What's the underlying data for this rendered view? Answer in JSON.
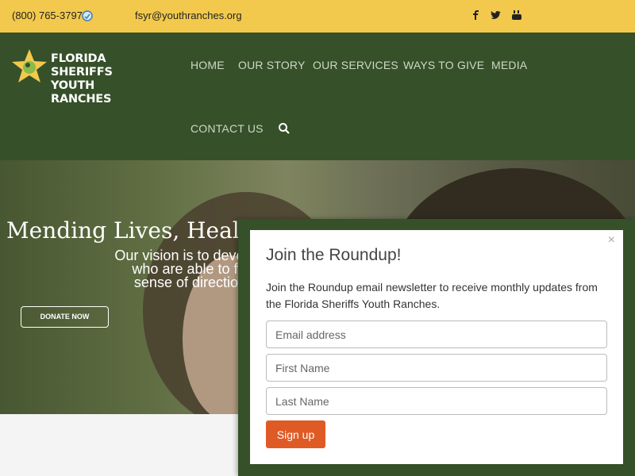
{
  "topbar": {
    "phone": "(800) 765-3797",
    "email": "fsyr@youthranches.org",
    "social": [
      "facebook-icon",
      "twitter-icon",
      "youtube-icon"
    ],
    "bg_color": "#f2c94c"
  },
  "header": {
    "logo_line1": "FLORIDA SHERIFFS",
    "logo_line2": "YOUTH RANCHES",
    "nav": [
      "HOME",
      "OUR STORY",
      "OUR SERVICES",
      "WAYS TO GIVE",
      "MEDIA",
      "CONTACT US"
    ],
    "bg_color": "#36502a"
  },
  "hero": {
    "title": "Mending Lives, Healing",
    "text_line1": "Our vision is to develop young me",
    "text_line2": "who are able to face the futu",
    "text_line3": "sense of direction, ability an",
    "donate_label": "DONATE NOW"
  },
  "popup": {
    "close": "×",
    "title": "Join the Roundup!",
    "description": "Join the Roundup email newsletter to receive monthly updates from the Florida Sheriffs Youth Ranches.",
    "email_placeholder": "Email address",
    "first_name_placeholder": "First Name",
    "last_name_placeholder": "Last Name",
    "signup_label": "Sign up",
    "button_color": "#e05a25"
  }
}
